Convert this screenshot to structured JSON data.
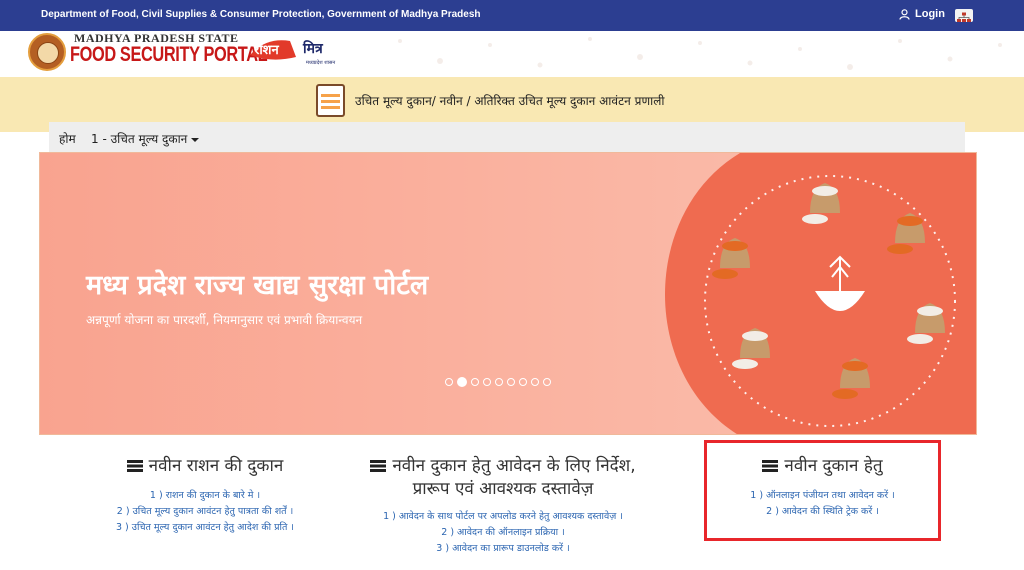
{
  "topbar": {
    "department": "Department of Food, Civil Supplies & Consumer Protection, Government of Madhya Pradesh",
    "login_label": "Login",
    "icons": [
      "user-icon",
      "sitemap-icon"
    ]
  },
  "logo": {
    "line1": "MADHYA PRADESH STATE",
    "line2": "FOOD SECURITY PORTAL",
    "ration_word": "राशन",
    "mitra_word": "मित्र",
    "tagline": "मध्यप्रदेश शासन"
  },
  "band": {
    "title": "उचित मूल्य दुकान/ नवीन / अतिरिक्त उचित मूल्य दुकान आवंटन प्रणाली"
  },
  "breadcrumb": {
    "home": "होम",
    "menu": "1 - उचित मूल्य दुकान"
  },
  "banner": {
    "title": "मध्य प्रदेश राज्य खाद्य सुरक्षा पोर्टल",
    "subtitle": "अन्नपूर्णा योजना का पारदर्शी, नियमानुसार एवं प्रभावी क्रियान्वयन",
    "slide_count": 9,
    "active_slide": 2
  },
  "columns": [
    {
      "title": "नवीन राशन की दुकान",
      "links": [
        "1 ) राशन की दुकान के बारे मे ।",
        "2 ) उचित मूल्य दुकान आवंटन हेतु पात्रता की शर्तें ।",
        "3 ) उचित मूल्य दुकान आवंटन हेतु आदेश की प्रति ।"
      ]
    },
    {
      "title_line1": "नवीन दुकान हेतु आवेदन के लिए निर्देश,",
      "title_line2": "प्रारूप एवं आवश्यक दस्तावेज़",
      "links": [
        "1 ) आवेदन के साथ पोर्टल पर अपलोड करने हेतु आवश्यक दस्तावेज़ ।",
        "2 ) आवेदन की ऑनलाइन प्रक्रिया ।",
        "3 ) आवेदन का प्रारूप डाउनलोड करें ।"
      ]
    },
    {
      "title": "नवीन दुकान हेतु",
      "links": [
        "1 ) ऑनलाइन पंजीयन तथा आवेदन करें ।",
        "2 ) आवेदन की स्थिति ट्रेक करें ।"
      ]
    }
  ],
  "colors": {
    "topbar": "#2c3e91",
    "band": "#f9e8b3",
    "banner_left": "#f9a795",
    "banner_circle": "#ef6b50",
    "link": "#2a64b0",
    "highlight_box": "#e8262b"
  }
}
